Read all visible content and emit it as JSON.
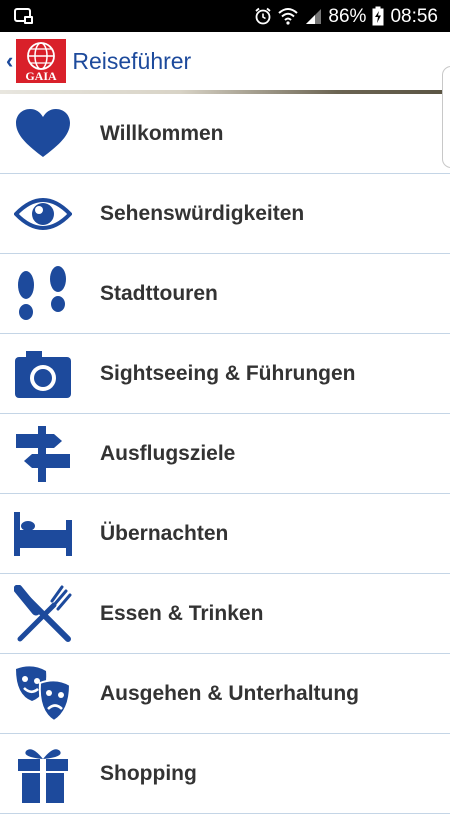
{
  "status_bar": {
    "battery": "86%",
    "time": "08:56"
  },
  "app_bar": {
    "title": "Reiseführer",
    "logo_text": "GAIA"
  },
  "colors": {
    "accent": "#1d4a9c",
    "logo_red": "#d9202a",
    "divider": "#c4d5e6"
  },
  "menu": {
    "items": [
      {
        "label": "Willkommen",
        "icon": "heart-icon"
      },
      {
        "label": "Sehenswürdigkeiten",
        "icon": "eye-icon"
      },
      {
        "label": "Stadttouren",
        "icon": "footprints-icon"
      },
      {
        "label": "Sightseeing & Führungen",
        "icon": "camera-icon"
      },
      {
        "label": "Ausflugsziele",
        "icon": "signpost-icon"
      },
      {
        "label": "Übernachten",
        "icon": "bed-icon"
      },
      {
        "label": "Essen & Trinken",
        "icon": "fork-knife-icon"
      },
      {
        "label": "Ausgehen & Unterhaltung",
        "icon": "theater-masks-icon"
      },
      {
        "label": "Shopping",
        "icon": "gift-icon"
      }
    ]
  }
}
